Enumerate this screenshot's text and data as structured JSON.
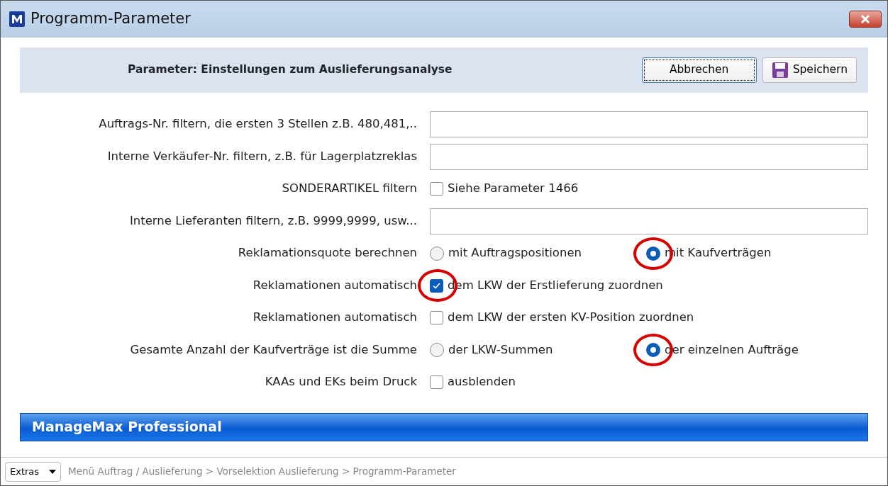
{
  "window": {
    "title": "Programm-Parameter"
  },
  "header": {
    "title": "Parameter: Einstellungen zum Auslieferungsanalyse",
    "buttons": [
      {
        "label": "Abbrechen",
        "kind": "cancel",
        "focused": true
      },
      {
        "label": "Speichern",
        "kind": "save",
        "focused": false
      }
    ]
  },
  "rows": [
    {
      "kind": "text",
      "label": "Auftrags-Nr. filtern, die ersten 3 Stellen z.B. 480,481,..",
      "value": ""
    },
    {
      "kind": "text",
      "label": "Interne Verkäufer-Nr. filtern, z.B. für Lagerplatzreklas",
      "value": ""
    },
    {
      "kind": "checkbox",
      "label": "SONDERARTIKEL filtern",
      "option": "Siehe Parameter 1466",
      "checked": false,
      "highlighted": false
    },
    {
      "kind": "text",
      "label": "Interne Lieferanten filtern, z.B. 9999,9999, usw...",
      "value": ""
    },
    {
      "kind": "radio",
      "label": "Reklamationsquote berechnen",
      "options": [
        {
          "label": "mit Auftragspositionen",
          "selected": false,
          "highlighted": false
        },
        {
          "label": "mit Kaufverträgen",
          "selected": true,
          "highlighted": true
        }
      ]
    },
    {
      "kind": "checkbox",
      "label": "Reklamationen automatisch",
      "option": "dem LKW der Erstlieferung zuordnen",
      "checked": true,
      "highlighted": true
    },
    {
      "kind": "checkbox",
      "label": "Reklamationen automatisch",
      "option": "dem LKW der ersten KV-Position zuordnen",
      "checked": false,
      "highlighted": false
    },
    {
      "kind": "radio",
      "label": "Gesamte Anzahl der Kaufverträge ist die Summe",
      "options": [
        {
          "label": "der LKW-Summen",
          "selected": false,
          "highlighted": false
        },
        {
          "label": "der einzelnen Aufträge",
          "selected": true,
          "highlighted": true
        }
      ]
    },
    {
      "kind": "checkbox",
      "label": "KAAs und EKs beim Druck",
      "option": "ausblenden",
      "checked": false,
      "highlighted": false
    }
  ],
  "banner": {
    "title": "ManageMax Professional"
  },
  "status_bar": {
    "menu": "Extras",
    "breadcrumb": "Menü Auftrag / Auslieferung > Vorselektion Auslieferung > Programm-Parameter"
  }
}
